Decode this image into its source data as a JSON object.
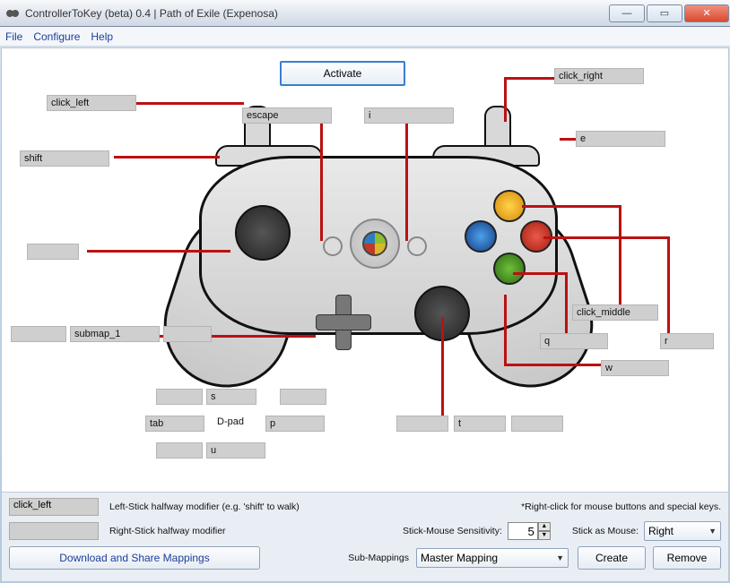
{
  "window": {
    "title": "ControllerToKey (beta) 0.4 | Path of Exile (Expenosa)"
  },
  "menu": {
    "file": "File",
    "configure": "Configure",
    "help": "Help"
  },
  "activate": "Activate",
  "map": {
    "lt": "click_left",
    "lb": "shift",
    "back": "escape",
    "start": "i",
    "rt": "click_right",
    "rb": "e",
    "ls_up": "",
    "ls_left": "",
    "ls_click": "submap_1",
    "ls_down": "",
    "dpad_up": "s",
    "dpad_left": "tab",
    "dpad_right": "p",
    "dpad_down": "u",
    "dpad_label": "D-pad",
    "rs_left": "",
    "rs_click": "t",
    "rs_right": "",
    "a": "q",
    "b": "r",
    "x": "w",
    "y": "click_middle"
  },
  "bottom": {
    "ls_half": "click_left",
    "ls_half_label": "Left-Stick halfway modifier (e.g. 'shift' to walk)",
    "rs_half": "",
    "rs_half_label": "Right-Stick halfway modifier",
    "hint": "*Right-click for mouse buttons and special keys.",
    "sens_label": "Stick-Mouse Sensitivity:",
    "sens_value": "5",
    "stick_mouse_label": "Stick as Mouse:",
    "stick_mouse_value": "Right",
    "download": "Download and Share Mappings",
    "submap_label": "Sub-Mappings",
    "submap_value": "Master Mapping",
    "create": "Create",
    "remove": "Remove"
  }
}
